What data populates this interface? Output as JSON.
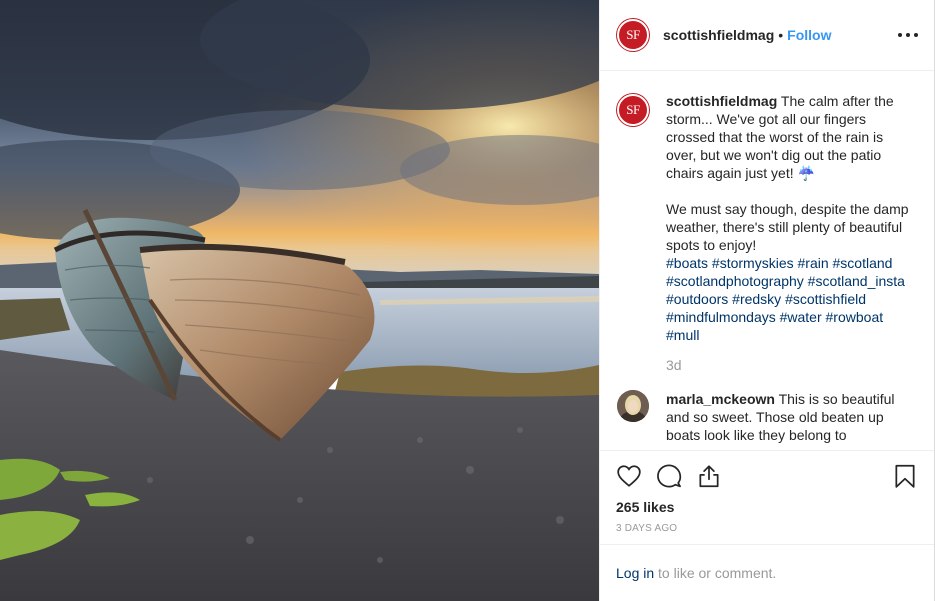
{
  "post": {
    "username": "scottishfieldmag",
    "separator": "•",
    "follow_label": "Follow",
    "avatar_initials": "SF",
    "caption_intro": "The calm after the storm... We've got all our fingers crossed that the worst of the rain is over, but we won't dig out the patio chairs again just yet! ☔",
    "caption_body": "We must say though, despite the damp weather, there's still plenty of beautiful spots to enjoy!",
    "hashtags": "#boats #stormyskies #rain #scotland #scotlandphotography #scotland_insta #outdoors #redsky #scottishfield #mindfulmondays #water #rowboat #mull",
    "caption_age": "3d"
  },
  "comment": {
    "username": "marla_mckeown",
    "text": "This is so beautiful and so sweet. Those old beaten up boats look like they belong to"
  },
  "engagement": {
    "likes": "265 likes",
    "posted": "3 DAYS AGO"
  },
  "footer": {
    "login_link": "Log in",
    "login_rest": " to like or comment."
  },
  "icons": {
    "like": "heart-icon",
    "comment": "comment-icon",
    "share": "share-icon",
    "save": "bookmark-icon",
    "more": "more-options-icon"
  },
  "colors": {
    "brand": "#c41b24",
    "follow": "#3897f0",
    "link": "#003569",
    "muted": "#999999"
  }
}
